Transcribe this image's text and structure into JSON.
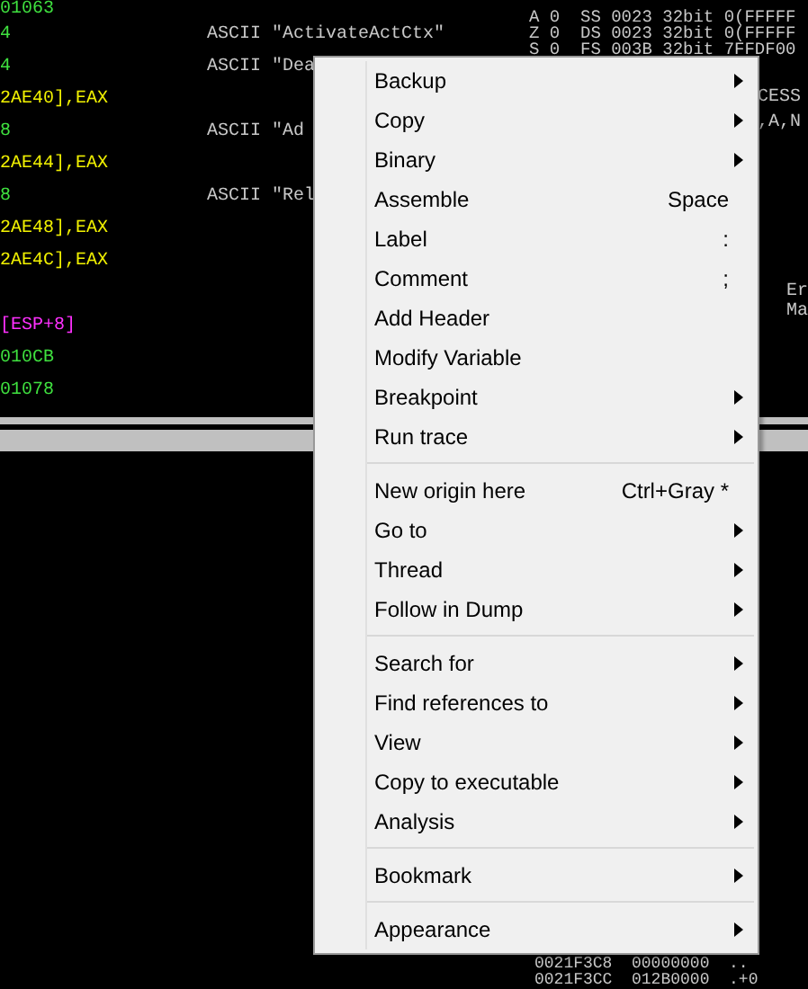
{
  "disassembly": [
    {
      "kind": "code",
      "address": "01063"
    },
    {
      "kind": "code",
      "address": "4",
      "comment": "ASCII \"ActivateActCtx\""
    },
    {
      "kind": "code",
      "address": "4",
      "comment": "ASCII \"Dea"
    },
    {
      "kind": "operand",
      "address": "2AE40],EAX"
    },
    {
      "kind": "code",
      "address": "8",
      "comment": "ASCII \"Ad"
    },
    {
      "kind": "operand",
      "address": "2AE44],EAX"
    },
    {
      "kind": "code",
      "address": "8",
      "comment": "ASCII \"Rel"
    },
    {
      "kind": "operand",
      "address": "2AE48],EAX"
    },
    {
      "kind": "operand",
      "address": "2AE4C],EAX"
    },
    {
      "kind": "gap"
    },
    {
      "kind": "stack",
      "address": "[ESP+8]"
    },
    {
      "kind": "code",
      "address": "010CB"
    },
    {
      "kind": "code",
      "address": "01078"
    }
  ],
  "registers": [
    "A 0  SS 0023 32bit 0(FFFFF",
    "Z 0  DS 0023 32bit 0(FFFFF",
    "S 0  FS 003B 32bit 7FFDF00"
  ],
  "register_notes": [
    "CESS",
    ",A,N",
    "Er",
    "Ma"
  ],
  "stack_rows": [
    "0021F3C8  00000000  ..",
    "0021F3CC  012B0000  .+0"
  ],
  "context_menu": [
    {
      "label": "Backup",
      "submenu": true
    },
    {
      "label": "Copy",
      "submenu": true
    },
    {
      "label": "Binary",
      "submenu": true
    },
    {
      "label": "Assemble",
      "shortcut": "Space"
    },
    {
      "label": "Label",
      "shortcut": ":"
    },
    {
      "label": "Comment",
      "shortcut": ";"
    },
    {
      "label": "Add Header"
    },
    {
      "label": "Modify Variable"
    },
    {
      "label": "Breakpoint",
      "submenu": true
    },
    {
      "label": "Run trace",
      "submenu": true,
      "separator_after": true
    },
    {
      "label": "New origin here",
      "shortcut": "Ctrl+Gray *"
    },
    {
      "label": "Go to",
      "submenu": true
    },
    {
      "label": "Thread",
      "submenu": true
    },
    {
      "label": "Follow in Dump",
      "submenu": true,
      "separator_after": true
    },
    {
      "label": "Search for",
      "submenu": true
    },
    {
      "label": "Find references to",
      "submenu": true
    },
    {
      "label": "View",
      "submenu": true
    },
    {
      "label": "Copy to executable",
      "submenu": true
    },
    {
      "label": "Analysis",
      "submenu": true,
      "separator_after": true
    },
    {
      "label": "Bookmark",
      "submenu": true,
      "separator_after": true
    },
    {
      "label": "Appearance",
      "submenu": true
    }
  ]
}
